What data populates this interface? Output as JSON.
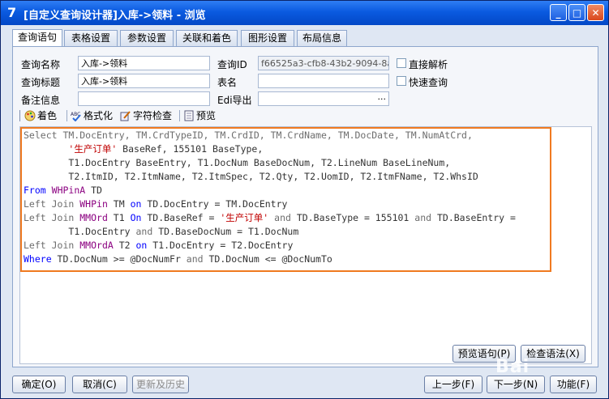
{
  "window": {
    "app_icon": "7",
    "title": "[自定义查询设计器]入库->领料 - 浏览",
    "minimize_glyph": "_",
    "maximize_glyph": "□",
    "close_glyph": "✕"
  },
  "tabs": [
    {
      "label": "查询语句",
      "active": true
    },
    {
      "label": "表格设置",
      "active": false
    },
    {
      "label": "参数设置",
      "active": false
    },
    {
      "label": "关联和着色",
      "active": false
    },
    {
      "label": "图形设置",
      "active": false
    },
    {
      "label": "布局信息",
      "active": false
    }
  ],
  "form": {
    "query_name_label": "查询名称",
    "query_name_value": "入库->领料",
    "query_title_label": "查询标题",
    "query_title_value": "入库->领料",
    "remark_label": "备注信息",
    "remark_value": "",
    "query_id_label": "查询ID",
    "query_id_value": "f66525a3-cfb8-43b2-9094-8a56",
    "table_name_label": "表名",
    "table_name_value": "",
    "edi_export_label": "Edi导出",
    "edi_export_value": "",
    "edi_export_ellipsis": "···",
    "direct_parse_label": "直接解析",
    "fast_query_label": "快速查询"
  },
  "toolbar": {
    "color_label": "着色",
    "format_label": "格式化",
    "charcheck_label": "字符检查",
    "preview_label": "预览"
  },
  "sql": {
    "l1": "Select TM.DocEntry, TM.CrdTypeID, TM.CrdID, TM.CrdName, TM.DocDate, TM.NumAtCrd,",
    "l2_str": "'生产订单'",
    "l2_rest": " BaseRef, 155101 BaseType,",
    "l3": "T1.DocEntry BaseEntry, T1.DocNum BaseDocNum, T2.LineNum BaseLineNum,",
    "l4": "T2.ItmID, T2.ItmName, T2.ItmSpec, T2.Qty, T2.UomID, T2.ItmFName, T2.WhsID",
    "l5_kw": "From",
    "l5_tbl": "WHPinA",
    "l5_rest": " TD",
    "l6_kw": "Left Join",
    "l6_tbl": "WHPin",
    "l6_mid": " TM ",
    "l6_on": "on",
    "l6_rest": " TD.DocEntry = TM.DocEntry",
    "l7_kw": "Left Join",
    "l7_tbl": "MMOrd",
    "l7_mid": " T1 ",
    "l7_on": "On",
    "l7_a": " TD.BaseRef = ",
    "l7_str": "'生产订单'",
    "l7_and1": "and",
    "l7_b": " TD.BaseType = 155101 ",
    "l7_and2": "and",
    "l7_c": " TD.BaseEntry =",
    "l8_a": "T1.DocEntry ",
    "l8_and": "and",
    "l8_b": " TD.BaseDocNum = T1.DocNum",
    "l9_kw": "Left Join",
    "l9_tbl": "MMOrdA",
    "l9_mid": " T2 ",
    "l9_on": "on",
    "l9_rest": " T1.DocEntry = T2.DocEntry",
    "l10_kw": "Where",
    "l10_a": " TD.DocNum >= @DocNumFr ",
    "l10_and": "and",
    "l10_b": " TD.DocNum <= @DocNumTo"
  },
  "buttons": {
    "preview_sql": "预览语句(P)",
    "check_syntax": "检查语法(X)",
    "ok": "确定(O)",
    "cancel": "取消(C)",
    "update_history": "更新及历史",
    "prev_step": "上一步(F)",
    "next_step": "下一步(N)",
    "function": "功能(F)"
  },
  "watermark": "Bai"
}
